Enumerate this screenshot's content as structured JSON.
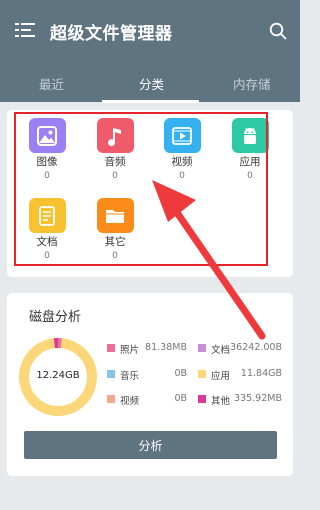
{
  "header": {
    "title": "超级文件管理器",
    "background": "#5f7481"
  },
  "tabs": [
    {
      "label": "最近",
      "active": false
    },
    {
      "label": "分类",
      "active": true
    },
    {
      "label": "内存储",
      "active": false
    }
  ],
  "categories": [
    {
      "label": "图像",
      "count": "0",
      "icon": "image-icon",
      "color": "#9b7ff5"
    },
    {
      "label": "音频",
      "count": "0",
      "icon": "music-note-icon",
      "color": "#ef5b6a"
    },
    {
      "label": "视频",
      "count": "0",
      "icon": "video-play-icon",
      "color": "#35b1f0"
    },
    {
      "label": "应用",
      "count": "0",
      "icon": "android-app-icon",
      "color": "#2cc9a3"
    },
    {
      "label": "文档",
      "count": "0",
      "icon": "document-icon",
      "color": "#f7c12f"
    },
    {
      "label": "其它",
      "count": "0",
      "icon": "folder-icon",
      "color": "#fb8c1a"
    }
  ],
  "disk": {
    "title": "磁盘分析",
    "total": "12.24GB",
    "legend": [
      {
        "name": "照片",
        "value": "81.38MB",
        "color": "#f06f97"
      },
      {
        "name": "文档",
        "value": "36242.00B",
        "color": "#c78ed9"
      },
      {
        "name": "音乐",
        "value": "0B",
        "color": "#87c4ea"
      },
      {
        "name": "应用",
        "value": "11.84GB",
        "color": "#fbd779"
      },
      {
        "name": "视频",
        "value": "0B",
        "color": "#f4a78c"
      },
      {
        "name": "其他",
        "value": "335.92MB",
        "color": "#d8399c"
      }
    ],
    "button_label": "分析"
  },
  "annotation_colors": {
    "highlight": "#e4232a"
  }
}
